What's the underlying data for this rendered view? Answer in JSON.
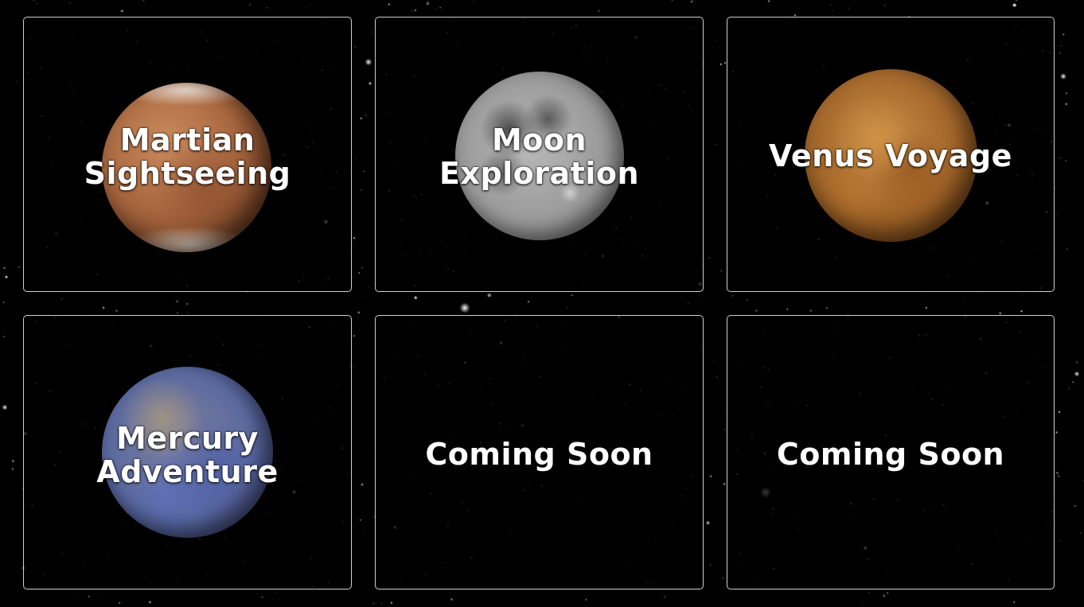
{
  "destinations": [
    {
      "line1": "Martian",
      "line2": "Sightseeing",
      "planet": "mars-image"
    },
    {
      "line1": "Moon",
      "line2": "Exploration",
      "planet": "moon-image"
    },
    {
      "line1": "Venus Voyage",
      "planet": "venus-image"
    },
    {
      "line1": "Mercury",
      "line2": "Adventure",
      "planet": "mercury-image"
    },
    {
      "line1": "Coming Soon"
    },
    {
      "line1": "Coming Soon"
    }
  ],
  "colors": {
    "background": "#000000",
    "card_border": "#cfcfcf",
    "text": "#ffffff"
  }
}
